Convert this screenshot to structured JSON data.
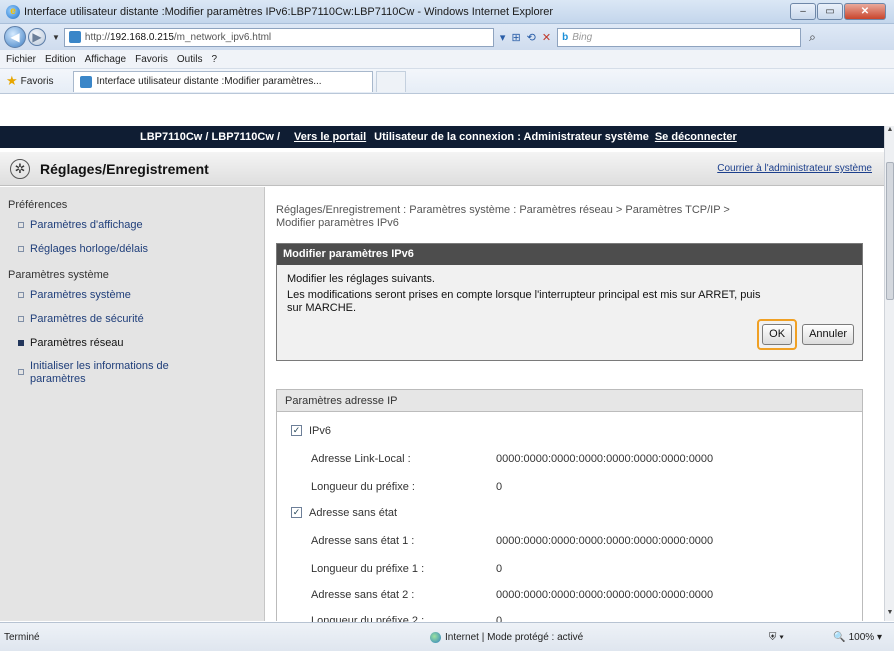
{
  "window": {
    "title": "Interface utilisateur distante :Modifier paramètres IPv6:LBP7110Cw:LBP7110Cw - Windows Internet Explorer",
    "url_prefix": "http://",
    "url_host": "192.168.0.215",
    "url_path": "/m_network_ipv6.html",
    "search_placeholder": "Bing",
    "search_brand": "b"
  },
  "menu": [
    "Fichier",
    "Edition",
    "Affichage",
    "Favoris",
    "Outils",
    "?"
  ],
  "favorites": {
    "label": "Favoris",
    "tab_title": "Interface utilisateur distante :Modifier paramètres..."
  },
  "device_bar": {
    "device": "LBP7110Cw / LBP7110Cw /",
    "portal": "Vers le portail",
    "user": "Utilisateur de la connexion : Administrateur système",
    "logout": "Se déconnecter"
  },
  "header": {
    "title": "Réglages/Enregistrement",
    "contact": "Courrier à l'administrateur système"
  },
  "sidebar": {
    "group1": "Préférences",
    "group1_items": [
      "Paramètres d'affichage",
      "Réglages horloge/délais"
    ],
    "group2": "Paramètres système",
    "group2_items": [
      "Paramètres système",
      "Paramètres de sécurité",
      "Paramètres réseau"
    ],
    "init_line1": "Initialiser les informations de",
    "init_line2": "paramètres"
  },
  "main": {
    "breadcrumb_line1": "Réglages/Enregistrement : Paramètres système : Paramètres réseau > Paramètres TCP/IP >",
    "breadcrumb_line2": "Modifier paramètres IPv6",
    "panel_title": "Modifier paramètres IPv6",
    "panel_line1": "Modifier les réglages suivants.",
    "panel_line2": "Les modifications seront prises en compte lorsque l'interrupteur principal est mis sur ARRET, puis",
    "panel_line3": "sur MARCHE.",
    "ok": "OK",
    "cancel": "Annuler",
    "section_title": "Paramètres adresse IP",
    "ipv6_label": "IPv6",
    "stateless_label": "Adresse sans état",
    "rows": [
      {
        "label": "Adresse Link-Local :",
        "value": "0000:0000:0000:0000:0000:0000:0000:0000"
      },
      {
        "label": "Longueur du préfixe :",
        "value": "0"
      },
      {
        "label": "Adresse sans état 1 :",
        "value": "0000:0000:0000:0000:0000:0000:0000:0000"
      },
      {
        "label": "Longueur du préfixe 1 :",
        "value": "0"
      },
      {
        "label": "Adresse sans état 2 :",
        "value": "0000:0000:0000:0000:0000:0000:0000:0000"
      },
      {
        "label": "Longueur du préfixe 2 :",
        "value": "0"
      }
    ]
  },
  "status": {
    "left": "Terminé",
    "zone": "Internet | Mode protégé : activé",
    "zoom": "100%"
  }
}
